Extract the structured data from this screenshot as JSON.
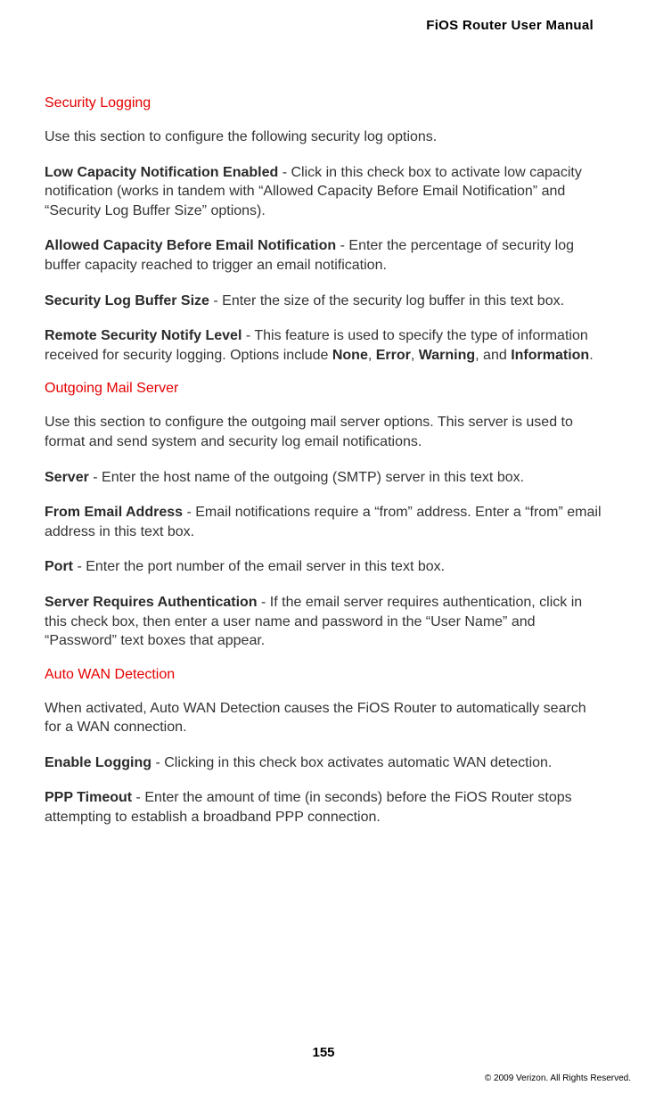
{
  "header": {
    "title": "FiOS Router User Manual"
  },
  "sections": {
    "security_logging": {
      "heading": "Security Logging",
      "intro": "Use this section to configure the following security log options.",
      "low_capacity_label": "Low Capacity Notification Enabled",
      "low_capacity_text": " - Click in this check box to activate low capacity notification (works in tandem with “Allowed Capacity Before Email Notification” and “Security Log Buffer Size” options).",
      "allowed_capacity_label": "Allowed Capacity Before Email Notification",
      "allowed_capacity_text": " - Enter the percentage of security log buffer capacity reached to trigger an email notification.",
      "buffer_size_label": "Security Log Buffer Size",
      "buffer_size_text": " - Enter the size of the security log buffer in this text box.",
      "remote_label": "Remote Security Notify Level",
      "remote_text_a": " - This feature is used to specify the type of information received for security logging. Options include ",
      "remote_none": "None",
      "remote_comma1": ", ",
      "remote_error": "Error",
      "remote_comma2": ", ",
      "remote_warning": "Warning",
      "remote_and": ", and ",
      "remote_information": "Information",
      "remote_period": "."
    },
    "outgoing_mail": {
      "heading": "Outgoing Mail Server",
      "intro": "Use this section to configure the outgoing mail server options. This server is used to format and send system and security log email notifications.",
      "server_label": "Server",
      "server_text": " - Enter the host name of the outgoing (SMTP) server in this text box.",
      "from_label": "From Email Address",
      "from_text": " - Email notifications require a “from” address. Enter a “from” email address in this text box.",
      "port_label": "Port",
      "port_text": " - Enter the port number of the email server in this text box.",
      "auth_label": "Server Requires Authentication",
      "auth_text": " - If the email server requires authentication, click in this check box, then enter a user name and password in the “User Name” and “Password” text boxes that appear."
    },
    "auto_wan": {
      "heading": "Auto WAN Detection",
      "intro": "When activated, Auto WAN Detection causes the FiOS Router to automatically search for a WAN connection.",
      "enable_label": "Enable Logging",
      "enable_text": " - Clicking in this check box activates automatic WAN detection.",
      "ppp_label": "PPP Timeout",
      "ppp_text": " - Enter the amount of time (in seconds) before the FiOS Router stops attempting to establish a broadband PPP connection."
    }
  },
  "footer": {
    "page_number": "155",
    "copyright": "© 2009 Verizon. All Rights Reserved."
  }
}
